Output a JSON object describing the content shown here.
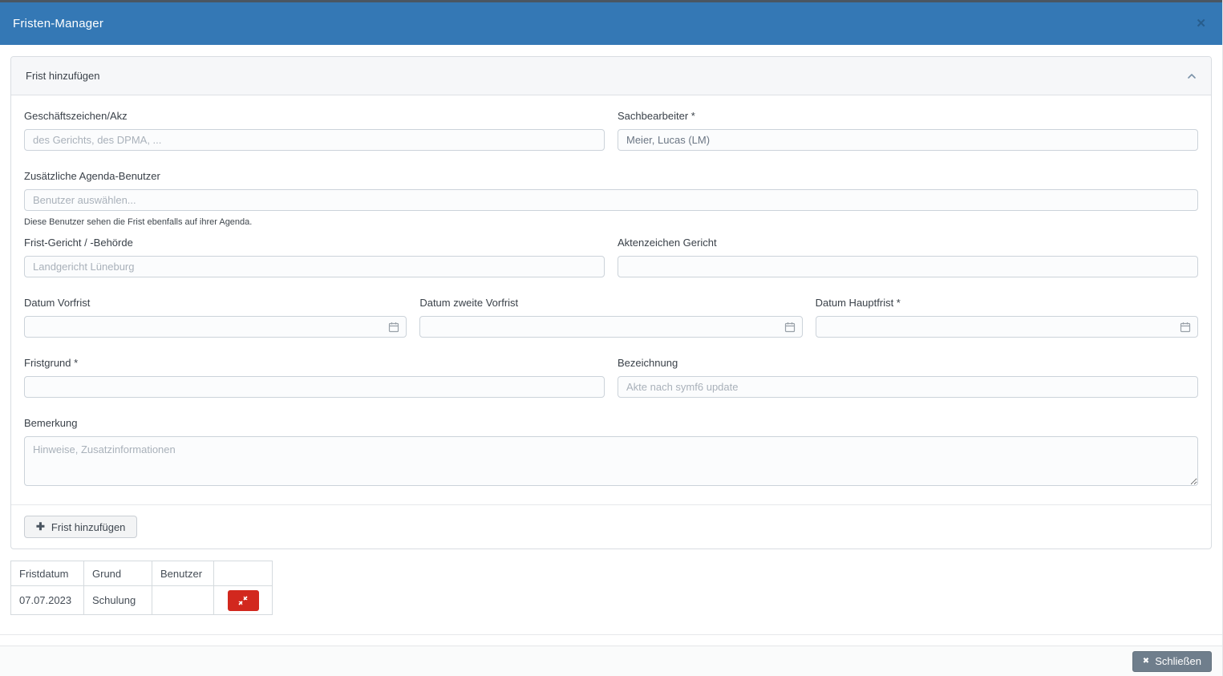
{
  "dialog": {
    "title": "Fristen-Manager",
    "close_glyph": "✕"
  },
  "panel": {
    "title": "Frist hinzufügen",
    "collapse_icon": "chevron-up"
  },
  "form": {
    "geschaeftszeichen": {
      "label": "Geschäftszeichen/Akz",
      "placeholder": "des Gerichts, des DPMA, ..."
    },
    "sachbearbeiter": {
      "label": "Sachbearbeiter *",
      "value": "Meier, Lucas (LM)"
    },
    "agenda_benutzer": {
      "label": "Zusätzliche Agenda-Benutzer",
      "placeholder": "Benutzer auswählen..."
    },
    "agenda_note": "Diese Benutzer sehen die Frist ebenfalls auf ihrer Agenda.",
    "frist_gericht": {
      "label": "Frist-Gericht / -Behörde",
      "placeholder": "Landgericht Lüneburg"
    },
    "aktenzeichen_gericht": {
      "label": "Aktenzeichen Gericht",
      "value": ""
    },
    "datum_vorfrist": {
      "label": "Datum Vorfrist",
      "value": ""
    },
    "datum_zweite_vorfrist": {
      "label": "Datum zweite Vorfrist",
      "value": ""
    },
    "datum_hauptfrist": {
      "label": "Datum Hauptfrist *",
      "value": ""
    },
    "fristgrund": {
      "label": "Fristgrund *",
      "value": ""
    },
    "bezeichnung": {
      "label": "Bezeichnung",
      "placeholder": "Akte nach symf6 update"
    },
    "bemerkung": {
      "label": "Bemerkung",
      "placeholder": "Hinweise, Zusatzinformationen"
    },
    "add_button": {
      "label": "Frist hinzufügen",
      "plus_glyph": "✚"
    }
  },
  "table": {
    "headers": [
      "Fristdatum",
      "Grund",
      "Benutzer",
      ""
    ],
    "rows": [
      {
        "fristdatum": "07.07.2023",
        "grund": "Schulung",
        "benutzer": "",
        "action_icon": "unlink-icon"
      }
    ]
  },
  "footer": {
    "close_button": {
      "label": "Schließen",
      "x_glyph": "✖"
    }
  },
  "colors": {
    "header_blue": "#3478b5",
    "danger_red": "#d2281e",
    "close_slate": "#6f7e8c"
  }
}
